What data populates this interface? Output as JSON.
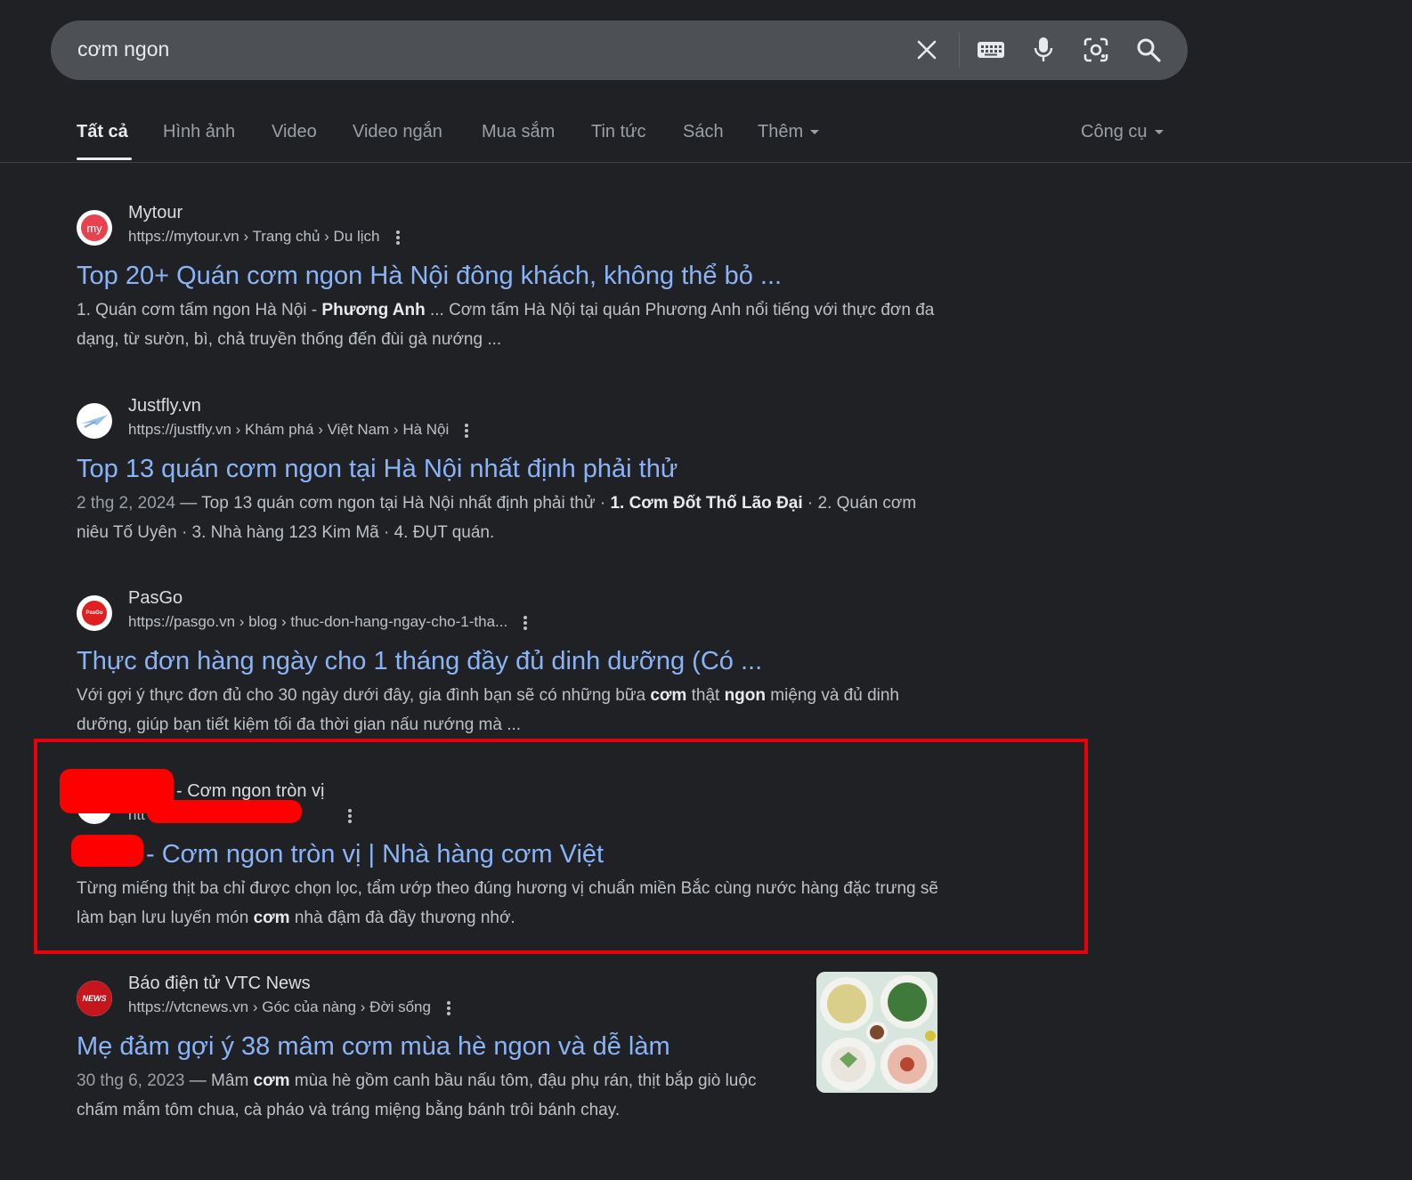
{
  "search": {
    "query": "cơm ngon"
  },
  "tabs": [
    {
      "label": "Tất cả"
    },
    {
      "label": "Hình ảnh"
    },
    {
      "label": "Video"
    },
    {
      "label": "Video ngắn"
    },
    {
      "label": "Mua sắm"
    },
    {
      "label": "Tin tức"
    },
    {
      "label": "Sách"
    },
    {
      "label": "Thêm"
    }
  ],
  "tools_label": "Công cụ",
  "results": [
    {
      "site": "Mytour",
      "url": "https://mytour.vn › Trang chủ › Du lịch",
      "favicon_text": "my",
      "title": "Top 20+ Quán cơm ngon Hà Nội đông khách, không thể bỏ ...",
      "snippet_a": "1. Quán cơm tấm ngon Hà Nội - ",
      "snippet_b": "Phương Anh",
      "snippet_c": " ... Cơm tấm Hà Nội tại quán Phương Anh nổi tiếng với thực đơn đa dạng, từ sườn, bì, chả truyền thống đến đùi gà nướng ..."
    },
    {
      "site": "Justfly.vn",
      "url": "https://justfly.vn › Khám phá › Việt Nam › Hà Nội",
      "title": "Top 13 quán cơm ngon tại Hà Nội nhất định phải thử",
      "date": "2 thg 2, 2024",
      "snippet_a": " — Top 13 quán cơm ngon tại Hà Nội nhất định phải thử · ",
      "snippet_b": "1. Cơm Đốt Thố Lão Đại",
      "snippet_c": " · 2. Quán cơm niêu Tố Uyên · 3. Nhà hàng 123 Kim Mã · 4. ĐỤT quán."
    },
    {
      "site": "PasGo",
      "url": "https://pasgo.vn › blog › thuc-don-hang-ngay-cho-1-tha...",
      "favicon_text": "PasGo",
      "title": "Thực đơn hàng ngày cho 1 tháng đầy đủ dinh dưỡng (Có ...",
      "snippet_a": "Với gợi ý thực đơn đủ cho 30 ngày dưới đây, gia đình bạn sẽ có những bữa ",
      "snippet_b": "cơm",
      "snippet_c": " thật ",
      "snippet_d": "ngon",
      "snippet_e": " miệng và đủ dinh dưỡng, giúp bạn tiết kiệm tối đa thời gian nấu nướng mà ..."
    },
    {
      "site": "- Cơm ngon tròn vị",
      "url": "htt",
      "title": "- Cơm ngon tròn vị | Nhà hàng cơm Việt",
      "snippet_a": "Từng miếng thịt ba chỉ được chọn lọc, tẩm ướp theo đúng hương vị chuẩn miền Bắc cùng nước hàng đặc trưng sẽ làm bạn lưu luyến món ",
      "snippet_b": "cơm",
      "snippet_c": " nhà đậm đà đầy thương nhớ."
    },
    {
      "site": "Báo điện tử VTC News",
      "url": "https://vtcnews.vn › Góc của nàng › Đời sống",
      "favicon_text": "NEWS",
      "title": "Mẹ đảm gợi ý 38 mâm cơm mùa hè ngon và dễ làm",
      "date": "30 thg 6, 2023",
      "snippet_a": " — Mâm ",
      "snippet_b": "cơm",
      "snippet_c": " mùa hè gồm canh bầu nấu tôm, đậu phụ rán, thịt bắp giò luộc chấm mắm tôm chua, cà pháo và tráng miệng bằng bánh trôi bánh chay."
    }
  ]
}
